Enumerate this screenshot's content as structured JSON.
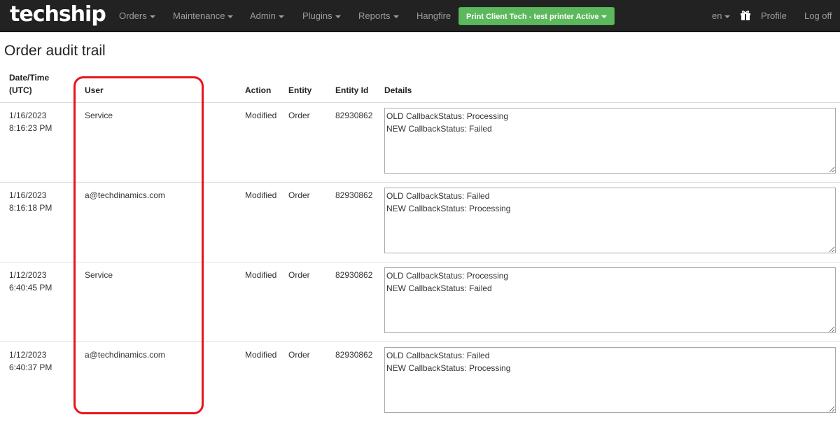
{
  "navbar": {
    "brand": "techship",
    "items": [
      {
        "label": "Orders"
      },
      {
        "label": "Maintenance"
      },
      {
        "label": "Admin"
      },
      {
        "label": "Plugins"
      },
      {
        "label": "Reports"
      },
      {
        "label": "Hangfire"
      }
    ],
    "status_button": "Print Client Tech - test printer Active",
    "language": "en",
    "gift_icon": "gift-icon",
    "profile": "Profile",
    "logoff": "Log off",
    "colors": {
      "bar": "#222222",
      "link": "#9d9d9d",
      "status_button": "#5cb85c"
    }
  },
  "page": {
    "title": "Order audit trail"
  },
  "table": {
    "headers": {
      "datetime_line1": "Date/Time",
      "datetime_line2": "(UTC)",
      "user": "User",
      "action": "Action",
      "entity": "Entity",
      "entity_id": "Entity Id",
      "details": "Details"
    },
    "rows": [
      {
        "date": "1/16/2023",
        "time": "8:16:23 PM",
        "user": "Service",
        "action": "Modified",
        "entity": "Order",
        "entity_id": "82930862",
        "details": "OLD CallbackStatus: Processing\nNEW CallbackStatus: Failed"
      },
      {
        "date": "1/16/2023",
        "time": "8:16:18 PM",
        "user": "a@techdinamics.com",
        "action": "Modified",
        "entity": "Order",
        "entity_id": "82930862",
        "details": "OLD CallbackStatus: Failed\nNEW CallbackStatus: Processing"
      },
      {
        "date": "1/12/2023",
        "time": "6:40:45 PM",
        "user": "Service",
        "action": "Modified",
        "entity": "Order",
        "entity_id": "82930862",
        "details": "OLD CallbackStatus: Processing\nNEW CallbackStatus: Failed"
      },
      {
        "date": "1/12/2023",
        "time": "6:40:37 PM",
        "user": "a@techdinamics.com",
        "action": "Modified",
        "entity": "Order",
        "entity_id": "82930862",
        "details": "OLD CallbackStatus: Failed\nNEW CallbackStatus: Processing"
      }
    ]
  },
  "annotation": {
    "highlight_color": "#e8141c"
  }
}
